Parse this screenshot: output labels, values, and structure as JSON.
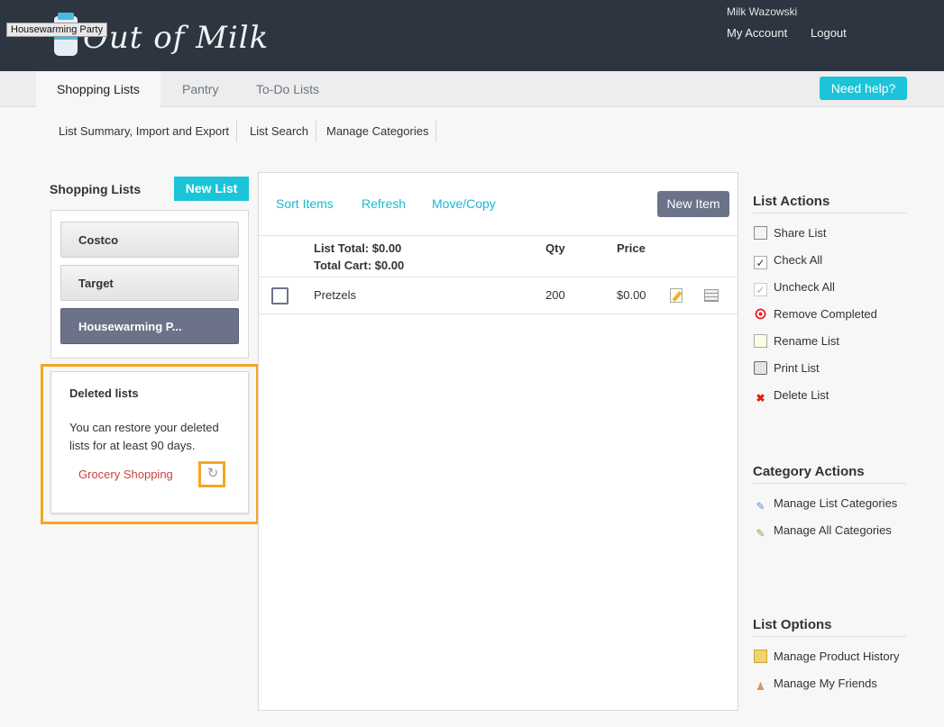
{
  "header": {
    "logo_text": "Out of Milk",
    "tooltip": "Housewarming Party",
    "user_name": "Milk Wazowski",
    "my_account": "My Account",
    "logout": "Logout"
  },
  "tabs": {
    "shopping": "Shopping Lists",
    "pantry": "Pantry",
    "todo": "To-Do Lists",
    "help": "Need help?"
  },
  "subnav": {
    "summary": "List Summary, Import and Export",
    "search": "List Search",
    "categories": "Manage Categories"
  },
  "left": {
    "title": "Shopping Lists",
    "new_list": "New List",
    "lists": [
      "Costco",
      "Target",
      "Housewarming P..."
    ],
    "deleted": {
      "title": "Deleted lists",
      "description": "You can restore your deleted lists for at least 90 days.",
      "item": "Grocery Shopping"
    }
  },
  "center": {
    "sort": "Sort Items",
    "refresh": "Refresh",
    "move_copy": "Move/Copy",
    "new_item": "New Item",
    "list_total": "List Total: $0.00",
    "cart_total": "Total Cart: $0.00",
    "col_qty": "Qty",
    "col_price": "Price",
    "items": [
      {
        "name": "Pretzels",
        "qty": "200",
        "price": "$0.00",
        "checked": false
      }
    ]
  },
  "right": {
    "list_actions_title": "List Actions",
    "list_actions": [
      "Share List",
      "Check All",
      "Uncheck All",
      "Remove Completed",
      "Rename List",
      "Print List",
      "Delete List"
    ],
    "category_actions_title": "Category Actions",
    "category_actions": [
      "Manage List Categories",
      "Manage All Categories"
    ],
    "list_options_title": "List Options",
    "list_options": [
      "Manage Product History",
      "Manage My Friends"
    ]
  },
  "colors": {
    "header_bg": "#2d3540",
    "accent": "#1cc4d9",
    "active_list": "#6c7388",
    "highlight": "#f5a623",
    "deleted_link": "#c9433d"
  }
}
